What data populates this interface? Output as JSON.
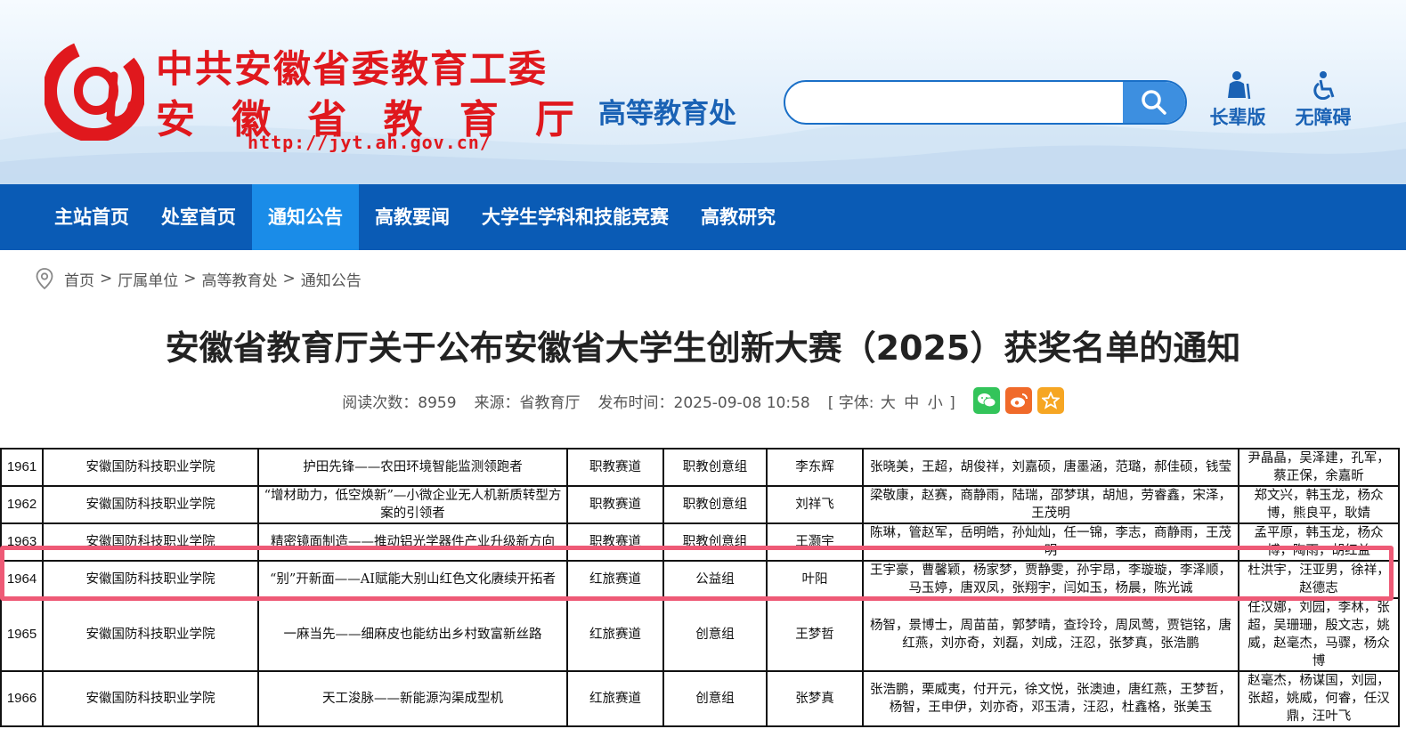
{
  "header": {
    "org_line1": "中共安徽省委教育工委",
    "org_line2": [
      "安",
      "徽",
      "省",
      "教",
      "育",
      "厅"
    ],
    "url": "http://jyt.ah.gov.cn/",
    "dept": "高等教育处",
    "search": {
      "placeholder": "",
      "value": ""
    },
    "tools": [
      {
        "label": "长辈版",
        "icon": "elder-icon"
      },
      {
        "label": "无障碍",
        "icon": "wheelchair-icon"
      }
    ],
    "colors": {
      "brand_red": "#e0181d",
      "brand_blue": "#1a62b5",
      "nav_blue": "#0a5bb5",
      "nav_active": "#1a8ce8"
    }
  },
  "nav": {
    "items": [
      "主站首页",
      "处室首页",
      "通知公告",
      "高教要闻",
      "大学生学科和技能竞赛",
      "高教研究"
    ],
    "active_index": 2
  },
  "breadcrumb": [
    "首页",
    "厅属单位",
    "高等教育处",
    "通知公告"
  ],
  "article": {
    "title": "安徽省教育厅关于公布安徽省大学生创新大赛（2025）获奖名单的通知",
    "reads_label": "阅读次数：",
    "reads": "8959",
    "source_label": "来源：",
    "source": "省教育厅",
    "date_label": "发布时间：",
    "date": "2025-09-08 10:58",
    "font_label": "[ 字体:",
    "font_sizes": [
      "大",
      "中",
      "小"
    ],
    "font_end": "]"
  },
  "table": {
    "rows": [
      {
        "no": "1961",
        "school": "安徽国防科技职业学院",
        "project": "护田先锋——农田环境智能监测领跑者",
        "track": "职教赛道",
        "group": "职教创意组",
        "leader": "李东辉",
        "members": "张晓美，王超，胡俊祥，刘嘉硕，唐墨涵，范璐，郝佳硕，钱莹",
        "advisors": "尹晶晶，吴泽建，孔军，蔡正保，余嘉昕"
      },
      {
        "no": "1962",
        "school": "安徽国防科技职业学院",
        "project": "“增材助力，低空焕新”—小微企业无人机新质转型方案的引领者",
        "track": "职教赛道",
        "group": "职教创意组",
        "leader": "刘祥飞",
        "members": "梁敬康，赵赛，商静雨，陆瑞，邵梦琪，胡旭，劳睿鑫，宋泽，王茂明",
        "advisors": "郑文兴，韩玉龙，杨众博，熊良平，耿婧"
      },
      {
        "no": "1963",
        "school": "安徽国防科技职业学院",
        "project": "精密镜面制造——推动铝光学器件产业升级新方向",
        "track": "职教赛道",
        "group": "职教创意组",
        "leader": "王灏宇",
        "members": "陈琳，管赵军，岳明皓，孙灿灿，任一锦，李志，商静雨，王茂明",
        "advisors": "孟平原，韩玉龙，杨众博，陶雨，胡红益"
      },
      {
        "no": "1964",
        "school": "安徽国防科技职业学院",
        "project": "“别”开新面——AI赋能大别山红色文化赓续开拓者",
        "track": "红旅赛道",
        "group": "公益组",
        "leader": "叶阳",
        "members": "王宇豪，曹馨颖，杨家梦，贾静雯，孙宇昂，李璇璇，李泽顺，马玉婷，唐双凤，张翔宇，闫如玉，杨晨，陈光诚",
        "advisors": "杜洪宇，汪亚男，徐祥，赵德志"
      },
      {
        "no": "1965",
        "school": "安徽国防科技职业学院",
        "project": "一麻当先——细麻皮也能纺出乡村致富新丝路",
        "track": "红旅赛道",
        "group": "创意组",
        "leader": "王梦哲",
        "members": "杨智，景博士，周苗苗，郭梦晴，查玲玲，周凤莺，贾铠铭，唐红燕，刘亦奇，刘磊，刘成，汪忍，张梦真，张浩鹏",
        "advisors": "任汉娜，刘园，李林，张超，吴珊珊，殷文志，姚威，赵毫杰，马骤，杨众博"
      },
      {
        "no": "1966",
        "school": "安徽国防科技职业学院",
        "project": "天工浚脉——新能源沟渠成型机",
        "track": "红旅赛道",
        "group": "创意组",
        "leader": "张梦真",
        "members": "张浩鹏，栗威夷，付开元，徐文悦，张澳迪，唐红燕，王梦哲，杨智，王申伊，刘亦奇，邓玉清，汪忍，杜鑫格，张美玉",
        "advisors": "赵毫杰，杨谋国，刘园，张超，姚威，何睿，任汉鼎，汪叶飞"
      }
    ],
    "highlight_row": "1964",
    "highlight_color": "#ee5a76"
  }
}
